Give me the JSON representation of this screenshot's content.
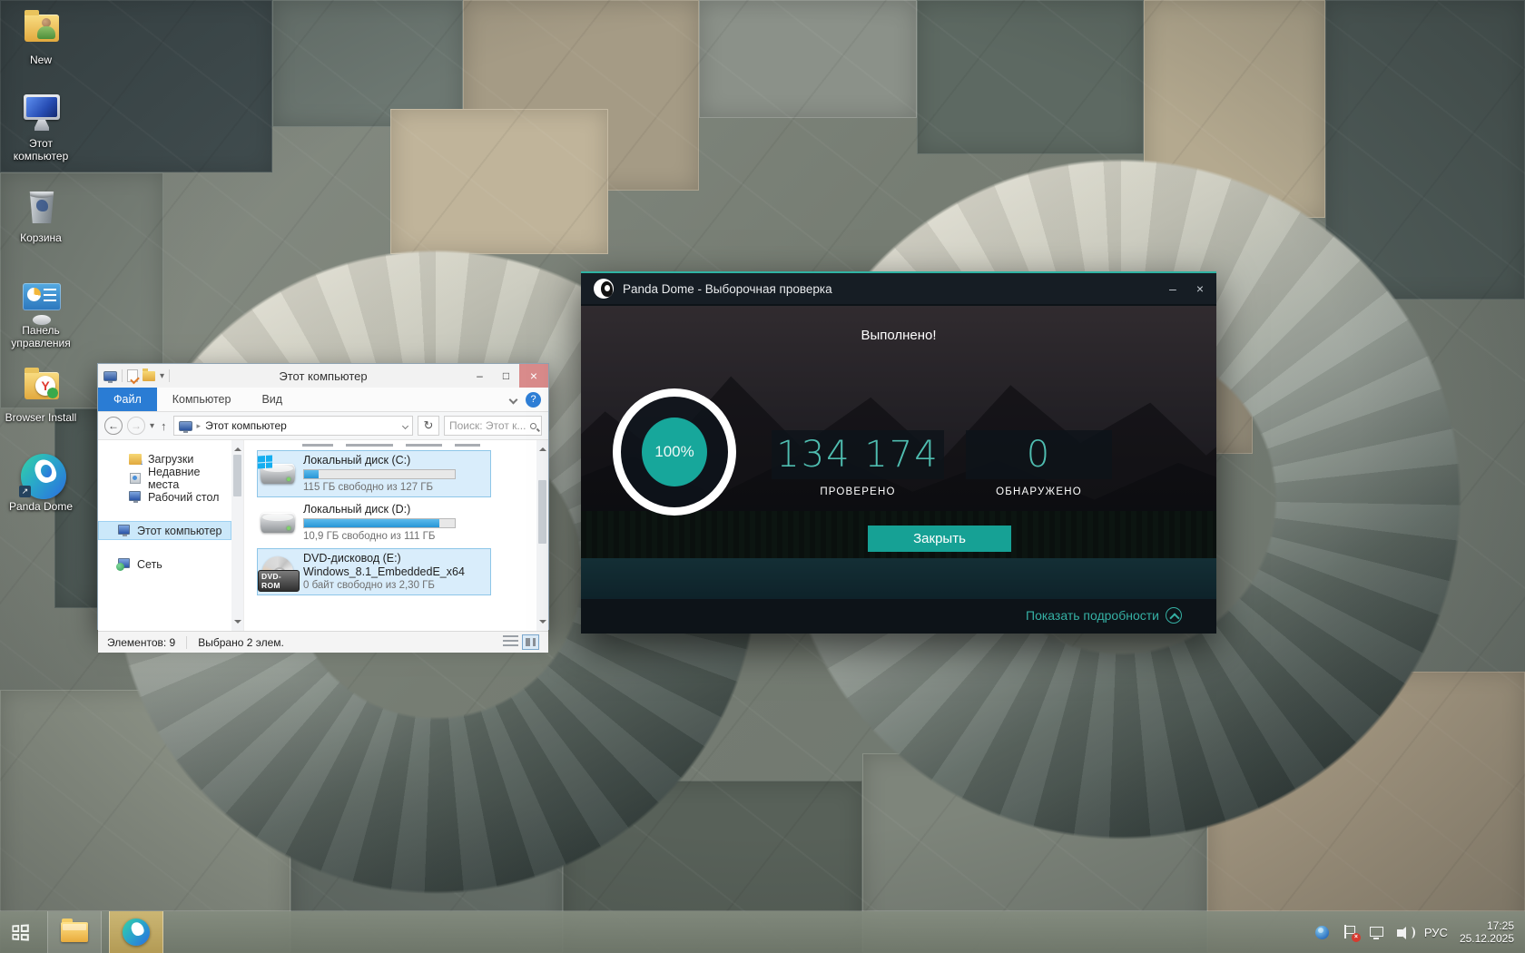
{
  "desktop": {
    "icons": [
      {
        "label": "New"
      },
      {
        "label": "Этот компьютер"
      },
      {
        "label": "Корзина"
      },
      {
        "label": "Панель управления"
      },
      {
        "label": "Browser Install"
      },
      {
        "label": "Panda Dome"
      }
    ]
  },
  "explorer": {
    "window_title": "Этот компьютер",
    "menu_tabs": [
      {
        "label": "Файл"
      },
      {
        "label": "Компьютер"
      },
      {
        "label": "Вид"
      }
    ],
    "address_text": "Этот компьютер",
    "search_placeholder": "Поиск: Этот к...",
    "nav_items": [
      {
        "label": "Загрузки"
      },
      {
        "label": "Недавние места"
      },
      {
        "label": "Рабочий стол"
      },
      {
        "label": "Этот компьютер"
      },
      {
        "label": "Сеть"
      }
    ],
    "drives": [
      {
        "name": "Локальный диск (C:)",
        "free_text": "115 ГБ свободно из 127 ГБ",
        "used_percent": "9.5%"
      },
      {
        "name": "Локальный диск (D:)",
        "free_text": "10,9 ГБ свободно из 111 ГБ",
        "used_percent": "90%"
      },
      {
        "name": "DVD-дисковод (E:)",
        "name_line2": "Windows_8.1_EmbeddedE_x64",
        "free_text": "0 байт свободно из 2,30 ГБ",
        "badge": "DVD-ROM"
      }
    ],
    "status_items": "Элементов: 9",
    "status_selected": "Выбрано 2 элем."
  },
  "panda": {
    "window_title": "Panda Dome - Выборочная проверка",
    "status_heading": "Выполнено!",
    "progress_percent": "100%",
    "scanned": {
      "value": "134 174",
      "label": "ПРОВЕРЕНО"
    },
    "detected": {
      "value": "0",
      "label": "ОБНАРУЖЕНО"
    },
    "close_button": "Закрыть",
    "details_link": "Показать подробности"
  },
  "taskbar": {
    "language": "РУС",
    "time": "17:25",
    "date": "25.12.2025"
  },
  "glyphs": {
    "minimize": "–",
    "maximize": "□",
    "close": "×",
    "back": "←",
    "forward": "→",
    "up": "↑",
    "refresh": "↻",
    "breadcrumb": "▸",
    "dropdown": "▾",
    "help": "?",
    "shortcut_arrow": "↗",
    "tray_error": "×"
  },
  "colors": {
    "panda_teal": "#16a195",
    "panda_dark": "#161d24",
    "selection_blue": "#d9edfb",
    "file_tab_blue": "#2a7cd4",
    "drive_bar_blue": "#2795d6"
  }
}
